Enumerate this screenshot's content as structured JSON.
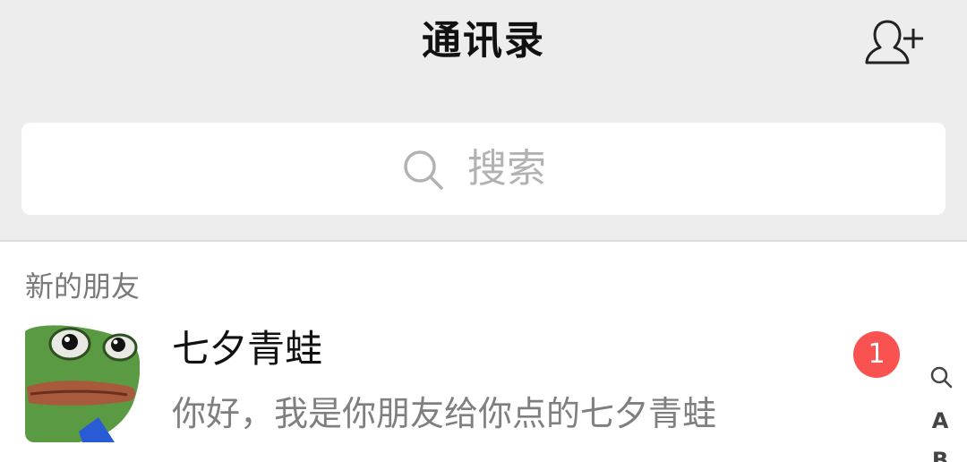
{
  "header": {
    "title": "通讯录",
    "add_friend_icon": "add-contact-icon"
  },
  "search": {
    "placeholder": "搜索",
    "icon": "search-icon"
  },
  "new_friends": {
    "section_title": "新的朋友",
    "items": [
      {
        "name": "七夕青蛙",
        "message": "你好，我是你朋友给你点的七夕青蛙",
        "badge": "1",
        "avatar_icon": "frog-avatar-icon"
      }
    ]
  },
  "index_bar": {
    "search_icon": "search-icon",
    "letters": [
      "A",
      "B"
    ]
  },
  "colors": {
    "background_top": "#ededed",
    "badge": "#fa5151",
    "secondary_text": "#7f7f7f",
    "placeholder": "#b2b2b2"
  }
}
